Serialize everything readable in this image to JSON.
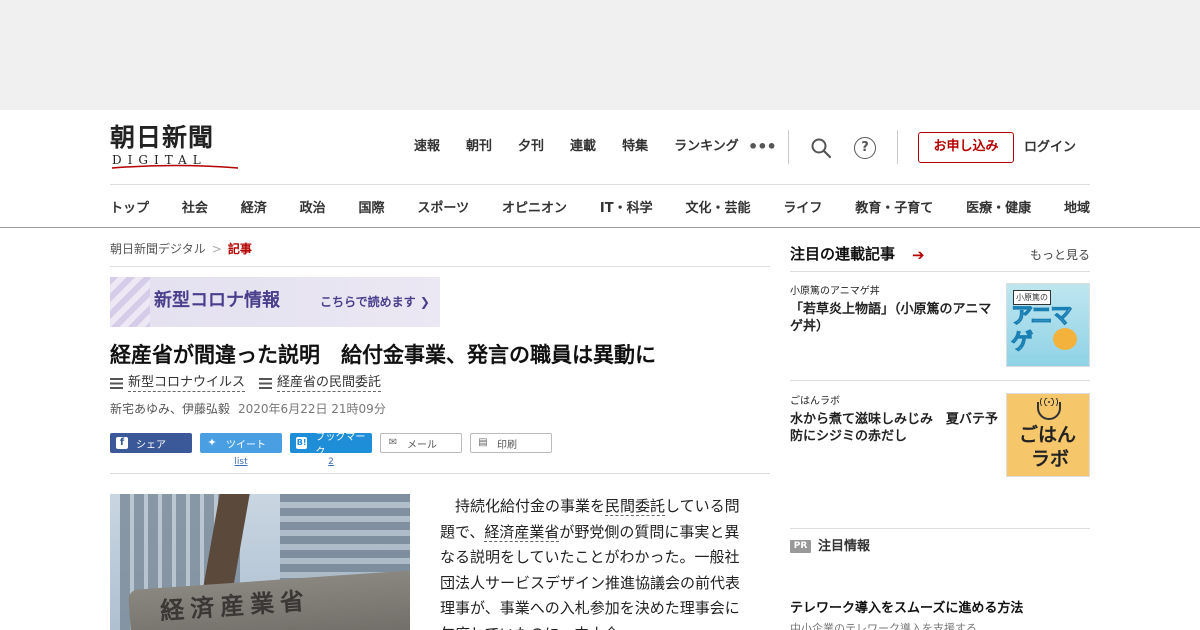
{
  "logo": {
    "main": "朝日新聞",
    "sub": "DIGITAL"
  },
  "top_nav": [
    "速報",
    "朝刊",
    "夕刊",
    "連載",
    "特集",
    "ランキング"
  ],
  "more_label": "•••",
  "help_label": "?",
  "subscribe_label": "お申し込み",
  "login_label": "ログイン",
  "genre_nav": [
    "トップ",
    "社会",
    "経済",
    "政治",
    "国際",
    "スポーツ",
    "オピニオン",
    "IT・科学",
    "文化・芸能",
    "ライフ",
    "教育・子育て",
    "医療・健康",
    "地域"
  ],
  "breadcrumb": {
    "home": "朝日新聞デジタル",
    "sep": ">",
    "current": "記事"
  },
  "corona_banner": {
    "title": "新型コロナ情報",
    "link": "こちらで読めます ❯"
  },
  "article": {
    "headline": "経産省が間違った説明　給付金事業、発言の職員は異動に",
    "tags": [
      "新型コロナウイルス",
      "経産省の民間委託"
    ],
    "authors": "新宅あゆみ、伊藤弘毅",
    "date": "2020年6月22日 21時09分",
    "photo_caption_text": "経済産業省",
    "body": {
      "p1": "持続化給付金の事業を",
      "kw1": "民間委託",
      "p2": "している問題で、",
      "kw2": "経済産業省",
      "p3": "が野党側の質問に事実と異なる説明をしていたことがわかった。一般社団法人サービスデザイン推進協議会の前代表理事が、事業への入札参加を決めた理事会に欠席していたのに、中小企"
    }
  },
  "share": {
    "facebook": "シェア",
    "twitter": "ツイート",
    "twitter_count": "list",
    "hatena": "ブックマーク",
    "hatena_icon": "B!",
    "hatena_count": "2",
    "mail": "メール",
    "print": "印刷"
  },
  "sidebar": {
    "title": "注目の連載記事",
    "more": "もっと見る",
    "items": [
      {
        "category": "小原篤のアニマゲ丼",
        "title": "「若草炎上物語」（小原篤のアニマゲ丼）",
        "thumb_top": "小原篤の",
        "thumb_main": "アニマゲ"
      },
      {
        "category": "ごはんラボ",
        "title": "水から煮て滋味しみじみ　夏バテ予防にシジミの赤だし",
        "thumb_line1": "ごはん",
        "thumb_line2": "ラボ"
      }
    ],
    "pr_badge": "PR",
    "pr_label": "注目情報",
    "pr_item_title": "テレワーク導入をスムーズに進める方法",
    "pr_item_desc": "中小企業のテレワーク導入を支援する"
  },
  "colors": {
    "brand_red": "#b40000",
    "facebook": "#3b5998",
    "twitter": "#4a9fe3",
    "hatena": "#1f8ed8"
  }
}
